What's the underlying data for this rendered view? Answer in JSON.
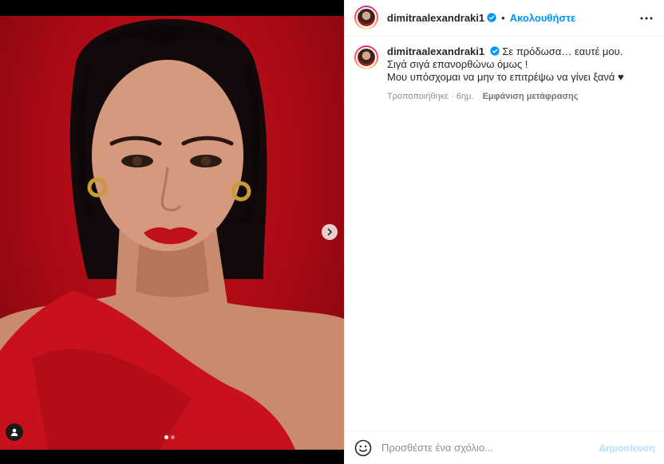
{
  "post": {
    "username": "dimitraalexandraki1",
    "follow_label": "Ακολουθήστε",
    "separator": "•",
    "verified_icon": "verified-badge-icon",
    "more_icon": "more-options-icon"
  },
  "caption": {
    "username": "dimitraalexandraki1",
    "line1": "Σε πρόδωσα… εαυτέ μου.",
    "line2": "Σιγά σιγά επανορθώνω όμως !",
    "line3": "Μου υπόσχομαι να μην το επιτρέψω να γίνει ξανά ♥",
    "edited": "Τροποποιήθηκε · 6ημ.",
    "translate_label": "Εμφάνιση μετάφρασης"
  },
  "comment": {
    "placeholder": "Προσθέστε ένα σχόλιο...",
    "post_label": "Δημοσίευση",
    "emoji_icon": "emoji-icon"
  },
  "media": {
    "carousel_total": 2,
    "carousel_index": 1,
    "next_icon": "chevron-right-icon",
    "tag_icon": "user-tag-icon"
  },
  "colors": {
    "accent": "#0095f6",
    "post_disabled": "#b2dffc",
    "background_red": "#b0101a"
  }
}
